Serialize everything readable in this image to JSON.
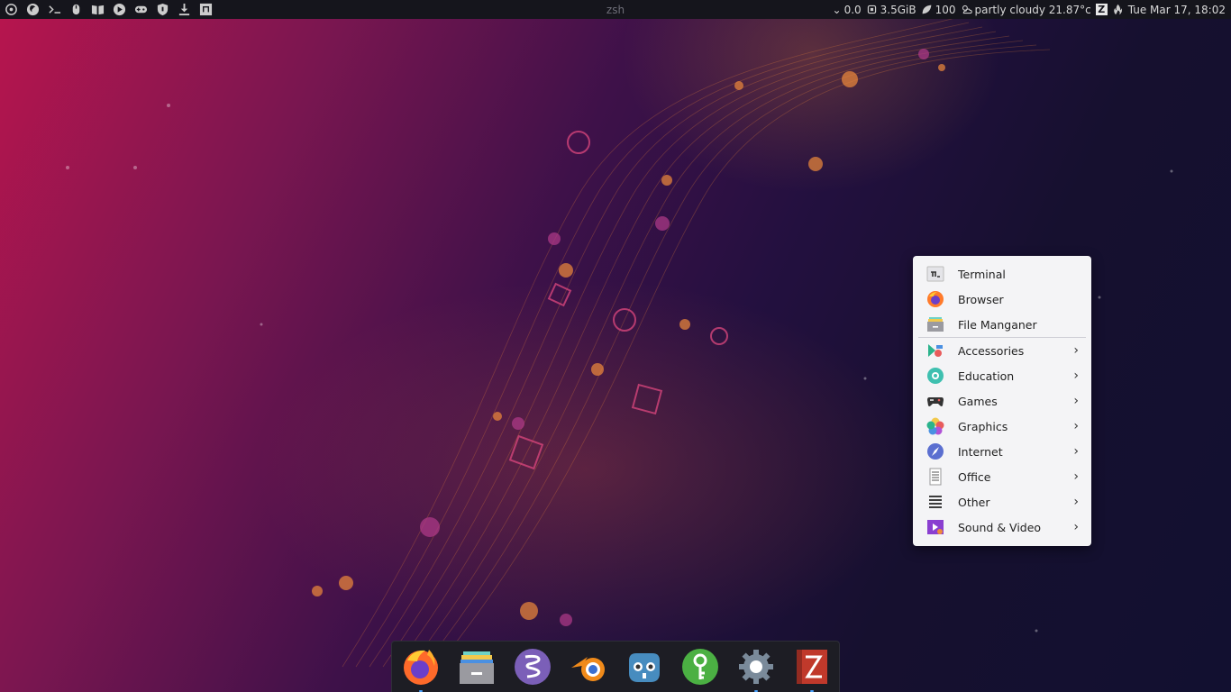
{
  "top_bar": {
    "window_title": "zsh",
    "launchers": [
      "power-icon",
      "firefox-icon",
      "terminal-icon",
      "mouse-icon",
      "book-icon",
      "play-icon",
      "gamepad-icon",
      "shield-icon",
      "download-icon",
      "music-icon"
    ],
    "status": {
      "load": "0.0",
      "memory": "3.5GiB",
      "battery": "100",
      "weather": "partly cloudy 21.87°c",
      "datetime": "Tue Mar 17, 18:02"
    }
  },
  "menu": {
    "items": [
      {
        "label": "Terminal",
        "icon": "terminal-icon",
        "submenu": false
      },
      {
        "label": "Browser",
        "icon": "firefox-icon",
        "submenu": false
      },
      {
        "label": "File Manganer",
        "icon": "file-manager-icon",
        "submenu": false
      },
      {
        "label": "Accessories",
        "icon": "accessories-icon",
        "submenu": true
      },
      {
        "label": "Education",
        "icon": "education-icon",
        "submenu": true
      },
      {
        "label": "Games",
        "icon": "gamepad-icon",
        "submenu": true
      },
      {
        "label": "Graphics",
        "icon": "graphics-icon",
        "submenu": true
      },
      {
        "label": "Internet",
        "icon": "internet-icon",
        "submenu": true
      },
      {
        "label": "Office",
        "icon": "office-icon",
        "submenu": true
      },
      {
        "label": "Other",
        "icon": "other-icon",
        "submenu": true
      },
      {
        "label": "Sound & Video",
        "icon": "sound-video-icon",
        "submenu": true
      }
    ],
    "chevron": "›"
  },
  "dock": {
    "apps": [
      {
        "name": "firefox",
        "running": true
      },
      {
        "name": "file-manager",
        "running": false
      },
      {
        "name": "emacs",
        "running": false
      },
      {
        "name": "blender",
        "running": false
      },
      {
        "name": "godot",
        "running": false
      },
      {
        "name": "keepassxc",
        "running": false
      },
      {
        "name": "settings",
        "running": true
      },
      {
        "name": "zeal",
        "running": true
      }
    ]
  },
  "colors": {
    "panel": "#15151c",
    "menu_bg": "#f4f4f6",
    "accent": "#4aa3ff"
  }
}
